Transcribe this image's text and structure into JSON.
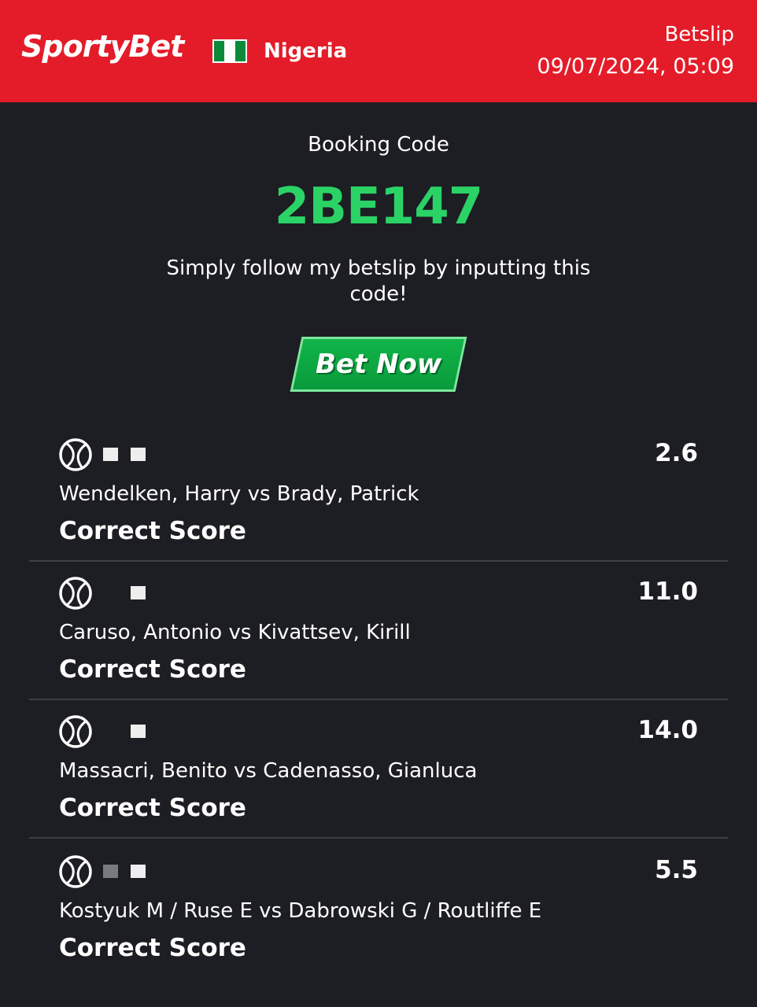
{
  "header": {
    "logo_text": "SportyBet",
    "country": "Nigeria",
    "title": "Betslip",
    "datetime": "09/07/2024, 05:09",
    "brand_color": "#e41b28"
  },
  "booking": {
    "label": "Booking Code",
    "code": "2BE147",
    "code_color": "#2bd266",
    "instructions": "Simply follow my betslip by inputting this code!",
    "bet_now_label": "Bet Now"
  },
  "bets": [
    {
      "sport_icon": "tennis-ball-icon",
      "odds": "2.6",
      "match": "Wendelken, Harry vs Brady, Patrick",
      "market": "Correct Score"
    },
    {
      "sport_icon": "tennis-ball-icon",
      "odds": "11.0",
      "match": "Caruso, Antonio vs Kivattsev, Kirill",
      "market": "Correct Score"
    },
    {
      "sport_icon": "tennis-ball-icon",
      "odds": "14.0",
      "match": "Massacri, Benito vs Cadenasso, Gianluca",
      "market": "Correct Score"
    },
    {
      "sport_icon": "tennis-ball-icon",
      "odds": "5.5",
      "match": "Kostyuk M / Ruse E vs Dabrowski G / Routliffe E",
      "market": "Correct Score"
    }
  ]
}
